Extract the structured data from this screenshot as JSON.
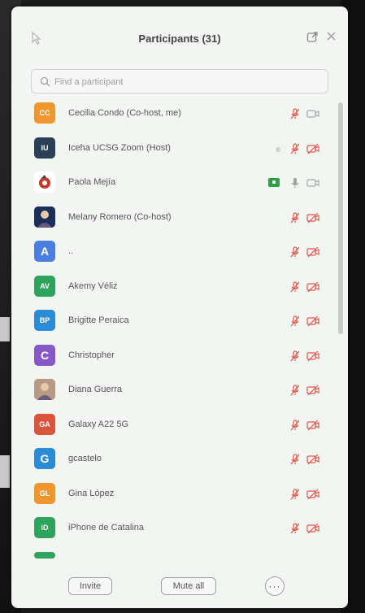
{
  "window": {
    "title": "Participants (31)"
  },
  "search": {
    "placeholder": "Find a participant"
  },
  "participants": [
    {
      "initials": "CC",
      "name": "Cecilia Condo (Co-host, me)",
      "avatar_color": "#f0962e",
      "mic": "muted",
      "camera": "off-gray"
    },
    {
      "initials": "IU",
      "name": "Iceha UCSG Zoom (Host)",
      "avatar_color": "#2b3f56",
      "mic": "muted",
      "camera": "off",
      "dot": true
    },
    {
      "initials": "",
      "name": "Paola Mejía",
      "avatar_color": "#ffffff",
      "avatar_type": "logo",
      "mic": "active",
      "camera": "off-gray",
      "sharing": true
    },
    {
      "initials": "",
      "name": "Melany Romero (Co-host)",
      "avatar_color": "#1c2f5a",
      "avatar_type": "photo",
      "mic": "muted",
      "camera": "off"
    },
    {
      "initials": "A",
      "name": "..",
      "avatar_color": "#4a7fe0",
      "mic": "muted",
      "camera": "off"
    },
    {
      "initials": "AV",
      "name": "Akemy Véliz",
      "avatar_color": "#2ea35b",
      "mic": "muted",
      "camera": "off"
    },
    {
      "initials": "BP",
      "name": "Brigitte Peraica",
      "avatar_color": "#2b8bd6",
      "mic": "muted",
      "camera": "off"
    },
    {
      "initials": "C",
      "name": "Christopher",
      "avatar_color": "#8657c9",
      "mic": "muted",
      "camera": "off"
    },
    {
      "initials": "",
      "name": "Diana Guerra",
      "avatar_color": "#b79a83",
      "avatar_type": "photo",
      "mic": "muted",
      "camera": "off"
    },
    {
      "initials": "GA",
      "name": "Galaxy A22 5G",
      "avatar_color": "#d9543b",
      "mic": "muted",
      "camera": "off"
    },
    {
      "initials": "G",
      "name": "gcastelo",
      "avatar_color": "#2b8bd6",
      "mic": "muted",
      "camera": "off"
    },
    {
      "initials": "GL",
      "name": "Gina López",
      "avatar_color": "#f0962e",
      "mic": "muted",
      "camera": "off"
    },
    {
      "initials": "iD",
      "name": "iPhone de Catalina",
      "avatar_color": "#2ea35b",
      "mic": "muted",
      "camera": "off"
    }
  ],
  "footer": {
    "invite_label": "Invite",
    "mute_all_label": "Mute all"
  },
  "colors": {
    "muted_red": "#e0584b",
    "panel_bg": "#f3f5f3",
    "text": "#555555",
    "sharing_green": "#2f9e44"
  }
}
